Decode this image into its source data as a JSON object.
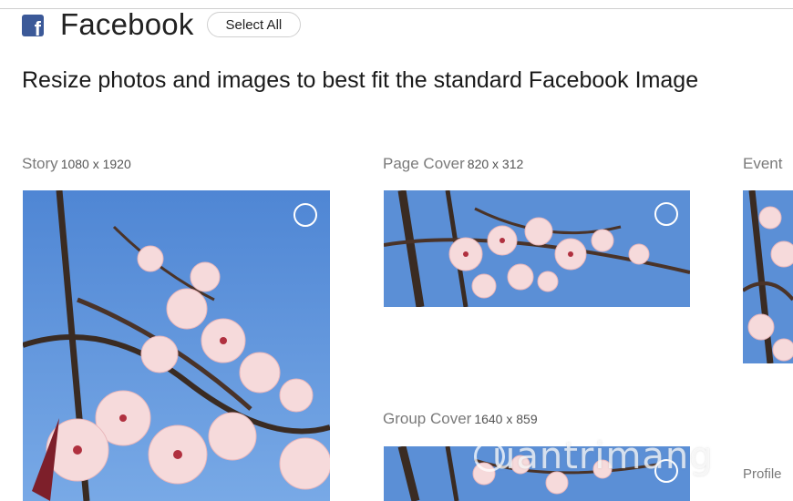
{
  "header": {
    "brand": "Facebook",
    "select_all_label": "Select All"
  },
  "subtitle": "Resize photos and images to best fit the standard Facebook Image",
  "presets": [
    {
      "name": "Story",
      "size": "1080 x 1920"
    },
    {
      "name": "Page Cover",
      "size": "820 x 312"
    },
    {
      "name": "Event",
      "size": ""
    },
    {
      "name": "Group Cover",
      "size": "1640 x 859"
    },
    {
      "name": "Profile",
      "size": ""
    }
  ],
  "watermark": "uantrimang",
  "colors": {
    "brand_blue": "#3b5998",
    "sky": "#5b8fd6",
    "blossom": "#f4d7d8",
    "branch": "#3a2b22"
  }
}
